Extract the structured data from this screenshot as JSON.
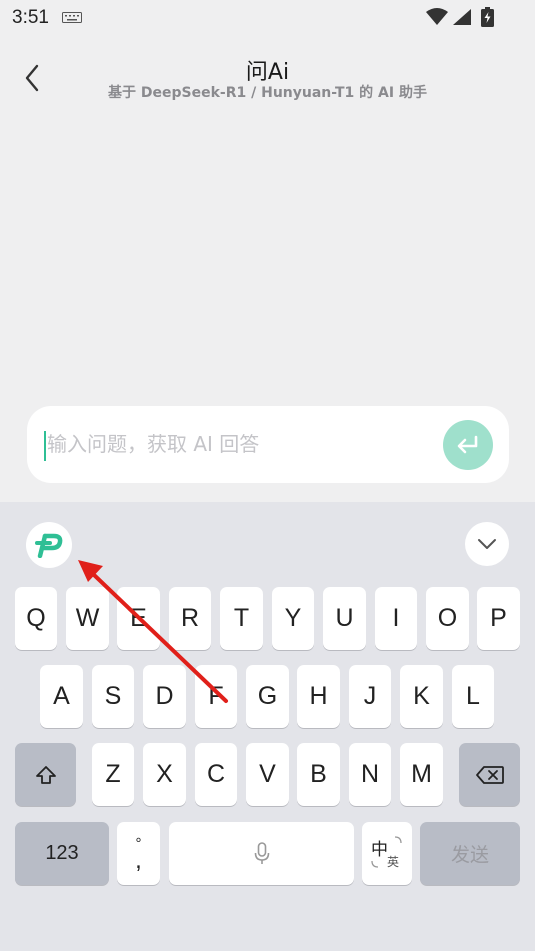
{
  "status": {
    "time": "3:51"
  },
  "header": {
    "title": "问Ai",
    "subtitle": "基于 DeepSeek-R1 / Hunyuan-T1 的 AI 助手"
  },
  "input": {
    "placeholder": "输入问题，获取 AI 回答",
    "value": ""
  },
  "keyboard": {
    "row1": [
      "Q",
      "W",
      "E",
      "R",
      "T",
      "Y",
      "U",
      "I",
      "O",
      "P"
    ],
    "row2": [
      "A",
      "S",
      "D",
      "F",
      "G",
      "H",
      "J",
      "K",
      "L"
    ],
    "row3": [
      "Z",
      "X",
      "C",
      "V",
      "B",
      "N",
      "M"
    ],
    "numbers_label": "123",
    "punct_top": "°",
    "punct_bottom": ",",
    "lang_main": "中",
    "lang_sub": "英",
    "send_label": "发送"
  },
  "colors": {
    "accent": "#2fbf95",
    "send_button_bg": "#9fe0cc",
    "annotation_arrow": "#e0201a"
  },
  "icons": {
    "back": "chevron-left-icon",
    "send": "enter-arrow-icon",
    "logo": "ime-logo-icon",
    "collapse": "chevron-down-icon",
    "shift": "shift-icon",
    "backspace": "backspace-icon",
    "mic": "microphone-icon"
  }
}
